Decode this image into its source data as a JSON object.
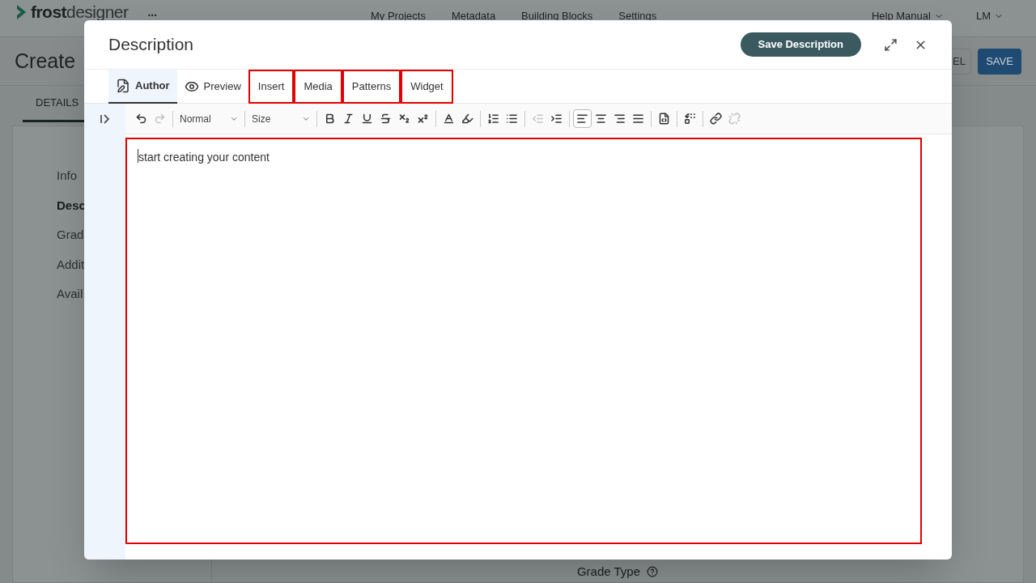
{
  "app_header": {
    "logo_bold": "frost",
    "logo_light": "designer",
    "more": "...",
    "nav": [
      "My Projects",
      "Metadata",
      "Building Blocks",
      "Settings"
    ],
    "help": "Help Manual",
    "user": "LM"
  },
  "page": {
    "title": "Create",
    "cancel": "EL",
    "save": "SAVE",
    "tabs": [
      {
        "label": "DETAILS",
        "selected": true
      }
    ],
    "sidebar": [
      {
        "label": "Info",
        "selected": false
      },
      {
        "label": "Desc",
        "selected": true
      },
      {
        "label": "Grad",
        "selected": false
      },
      {
        "label": "Addit",
        "selected": false
      },
      {
        "label": "Avail",
        "selected": false
      }
    ],
    "field_label": "Grade Type"
  },
  "dialog": {
    "title": "Description",
    "save": "Save Description",
    "tabs": [
      {
        "label": "Author",
        "kind": "author",
        "selected": true,
        "highlighted": false
      },
      {
        "label": "Preview",
        "kind": "preview",
        "selected": false,
        "highlighted": false
      },
      {
        "label": "Insert",
        "kind": "plain",
        "selected": false,
        "highlighted": true
      },
      {
        "label": "Media",
        "kind": "plain",
        "selected": false,
        "highlighted": true
      },
      {
        "label": "Patterns",
        "kind": "plain",
        "selected": false,
        "highlighted": true
      },
      {
        "label": "Widget",
        "kind": "plain",
        "selected": false,
        "highlighted": true
      }
    ],
    "toolbar": [
      {
        "kind": "undo",
        "disabled": false
      },
      {
        "kind": "redo",
        "disabled": true
      },
      {
        "kind": "separator"
      },
      {
        "kind": "dropdown",
        "label": "Normal"
      },
      {
        "kind": "separator"
      },
      {
        "kind": "dropdown",
        "label": "Size"
      },
      {
        "kind": "separator"
      },
      {
        "kind": "bold",
        "disabled": false
      },
      {
        "kind": "italic",
        "disabled": false
      },
      {
        "kind": "underline",
        "disabled": false
      },
      {
        "kind": "strike",
        "disabled": false
      },
      {
        "kind": "subscript",
        "disabled": false
      },
      {
        "kind": "superscript",
        "disabled": false
      },
      {
        "kind": "separator"
      },
      {
        "kind": "text-color",
        "disabled": false
      },
      {
        "kind": "highlight-color",
        "disabled": false
      },
      {
        "kind": "separator"
      },
      {
        "kind": "ordered-list",
        "disabled": false
      },
      {
        "kind": "bullet-list",
        "disabled": false
      },
      {
        "kind": "separator"
      },
      {
        "kind": "outdent",
        "disabled": true
      },
      {
        "kind": "indent",
        "disabled": false
      },
      {
        "kind": "separator"
      },
      {
        "kind": "align-left",
        "disabled": false,
        "selected": true
      },
      {
        "kind": "align-center",
        "disabled": false,
        "selected": false
      },
      {
        "kind": "align-right",
        "disabled": false,
        "selected": false
      },
      {
        "kind": "align-justify",
        "disabled": false,
        "selected": false
      },
      {
        "kind": "separator"
      },
      {
        "kind": "source",
        "disabled": false
      },
      {
        "kind": "separator"
      },
      {
        "kind": "replace",
        "disabled": false
      },
      {
        "kind": "separator"
      },
      {
        "kind": "link",
        "disabled": false
      },
      {
        "kind": "unlink",
        "disabled": true
      }
    ],
    "editor": {
      "placeholder": "start creating your content",
      "highlighted": true
    }
  }
}
